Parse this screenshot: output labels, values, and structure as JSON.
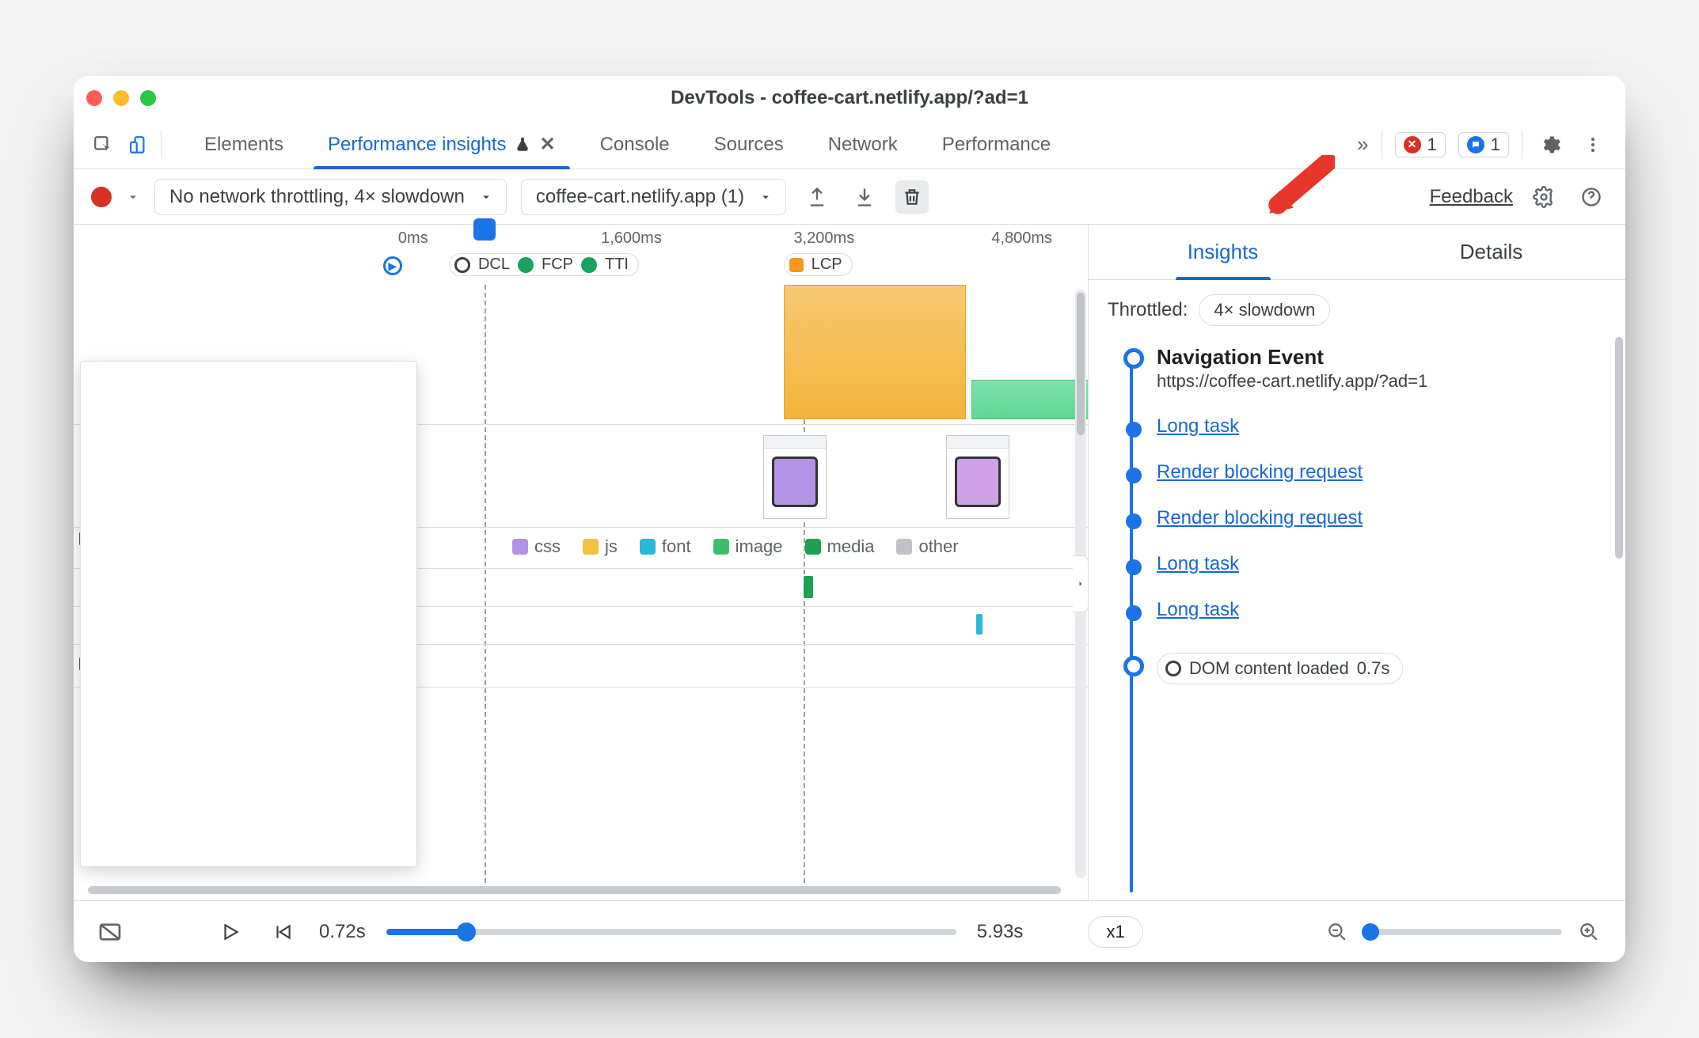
{
  "window": {
    "title": "DevTools - coffee-cart.netlify.app/?ad=1"
  },
  "tabs": {
    "items": [
      "Elements",
      "Performance insights",
      "Console",
      "Sources",
      "Network",
      "Performance"
    ],
    "active_index": 1,
    "close_visible_on": 1
  },
  "issues": {
    "errors": "1",
    "messages": "1"
  },
  "toolbar": {
    "throttling": "No network throttling, 4× slowdown",
    "recording": "coffee-cart.netlify.app (1)",
    "feedback": "Feedback"
  },
  "timeline": {
    "ticks": [
      "0ms",
      "1,600ms",
      "3,200ms",
      "4,800ms"
    ],
    "markers1": [
      "DCL",
      "FCP",
      "TTI"
    ],
    "marker_lcp": "LCP",
    "legend": [
      "css",
      "js",
      "font",
      "image",
      "media",
      "other"
    ]
  },
  "insights_tabs": {
    "items": [
      "Insights",
      "Details"
    ],
    "active_index": 0
  },
  "insights": {
    "throttled_label": "Throttled:",
    "throttled_value": "4× slowdown",
    "nav_title": "Navigation Event",
    "nav_url": "https://coffee-cart.netlify.app/?ad=1",
    "items": [
      "Long task",
      "Render blocking request",
      "Render blocking request",
      "Long task",
      "Long task"
    ],
    "dom_loaded_label": "DOM content loaded",
    "dom_loaded_time": "0.7s"
  },
  "footer": {
    "time_current": "0.72s",
    "time_total": "5.93s",
    "speed": "x1"
  }
}
